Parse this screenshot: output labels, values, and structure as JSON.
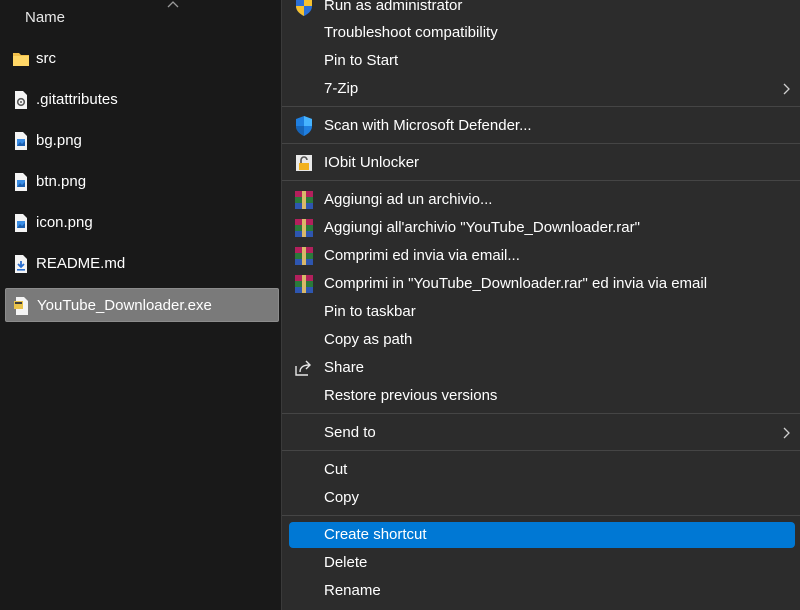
{
  "file_list": {
    "column_header": "Name",
    "items": [
      {
        "name": "src",
        "icon": "folder-icon"
      },
      {
        "name": ".gitattributes",
        "icon": "settings-file-icon"
      },
      {
        "name": "bg.png",
        "icon": "image-file-icon"
      },
      {
        "name": "btn.png",
        "icon": "image-file-icon"
      },
      {
        "name": "icon.png",
        "icon": "image-file-icon"
      },
      {
        "name": "README.md",
        "icon": "markdown-file-icon"
      },
      {
        "name": "YouTube_Downloader.exe",
        "icon": "exe-file-icon",
        "selected": true
      }
    ]
  },
  "context_menu": {
    "items": [
      {
        "label": "Run as administrator",
        "icon": "uac-shield-icon"
      },
      {
        "label": "Troubleshoot compatibility"
      },
      {
        "label": "Pin to Start"
      },
      {
        "label": "7-Zip",
        "submenu": true
      },
      {
        "label": "Scan with Microsoft Defender...",
        "icon": "defender-shield-icon"
      },
      {
        "label": "IObit Unlocker",
        "icon": "iobit-unlocker-icon"
      },
      {
        "label": "Aggiungi ad un archivio...",
        "icon": "winrar-icon"
      },
      {
        "label": "Aggiungi all'archivio \"YouTube_Downloader.rar\"",
        "icon": "winrar-icon"
      },
      {
        "label": "Comprimi ed invia via email...",
        "icon": "winrar-icon"
      },
      {
        "label": "Comprimi in \"YouTube_Downloader.rar\" ed invia via email",
        "icon": "winrar-icon"
      },
      {
        "label": "Pin to taskbar"
      },
      {
        "label": "Copy as path"
      },
      {
        "label": "Share",
        "icon": "share-icon"
      },
      {
        "label": "Restore previous versions"
      },
      {
        "label": "Send to",
        "submenu": true
      },
      {
        "label": "Cut"
      },
      {
        "label": "Copy"
      },
      {
        "label": "Create shortcut",
        "highlighted": true
      },
      {
        "label": "Delete"
      },
      {
        "label": "Rename"
      }
    ]
  },
  "colors": {
    "background": "#191919",
    "menu_background": "#2c2c2c",
    "selection": "#7a7a7a",
    "highlight": "#0078d4"
  }
}
